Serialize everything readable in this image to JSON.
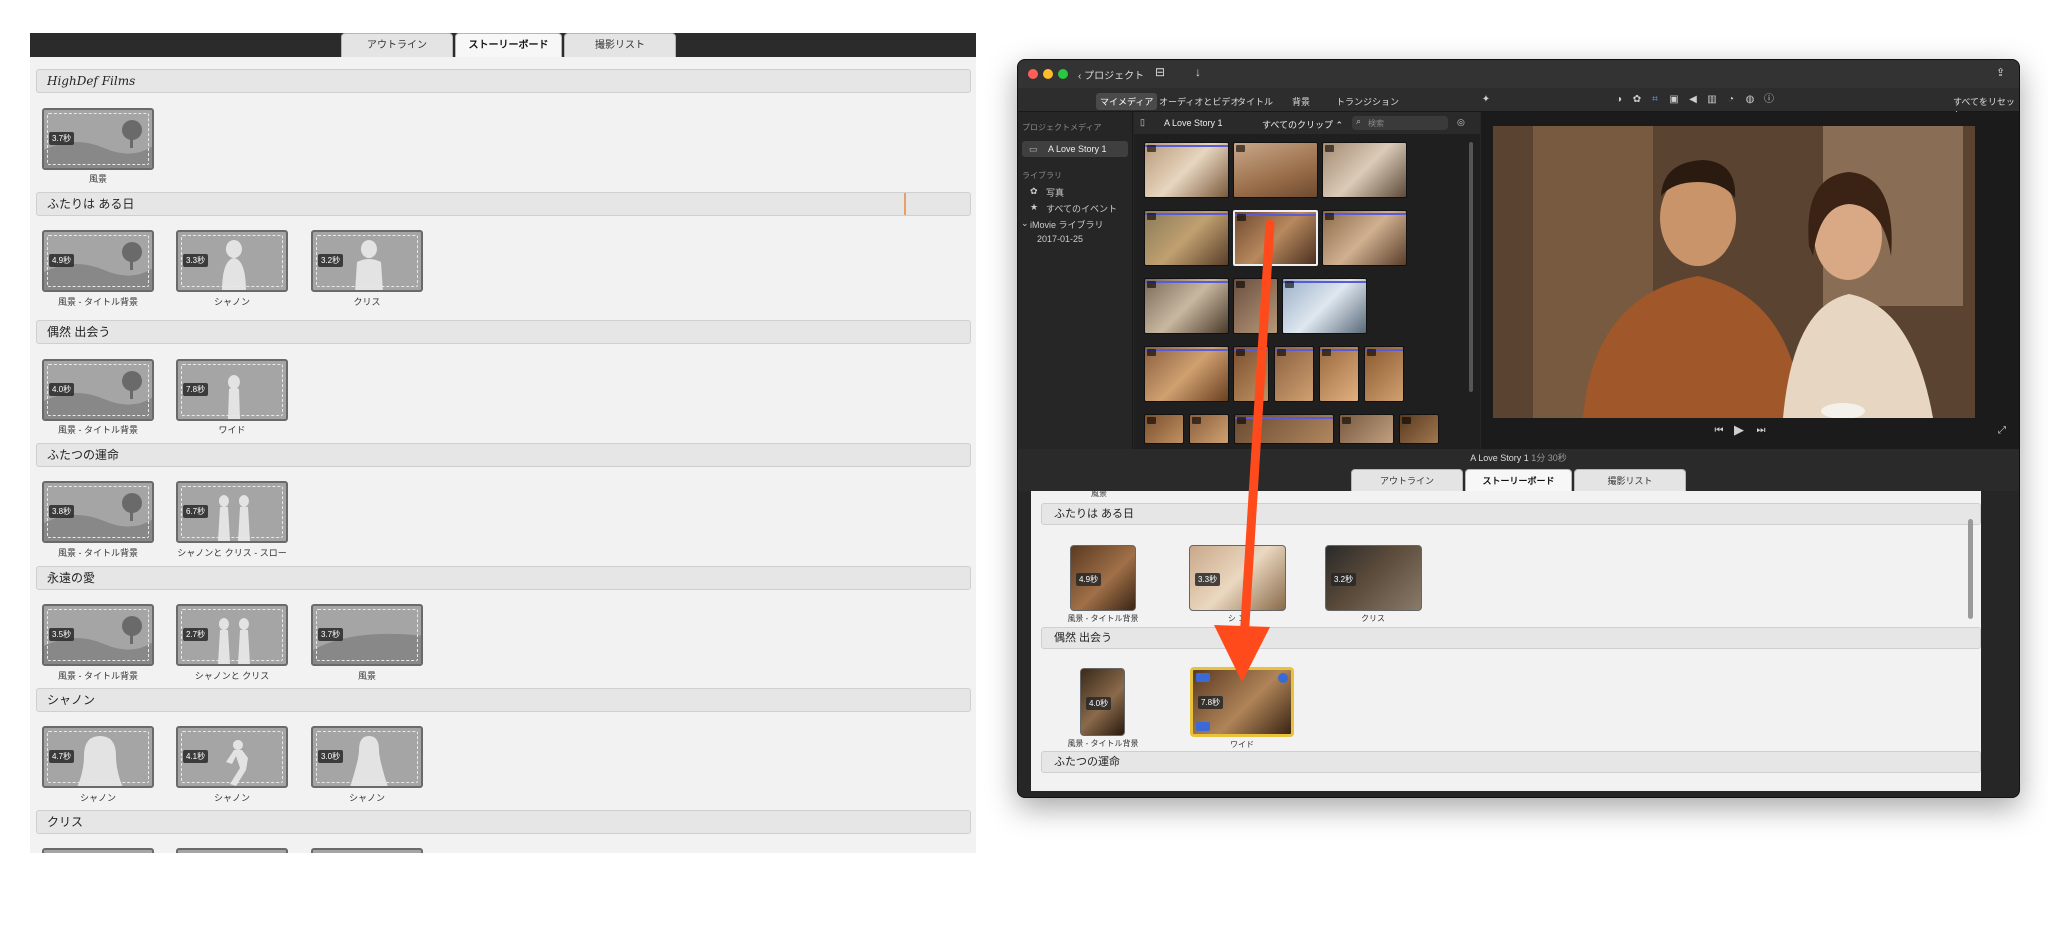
{
  "left": {
    "tabs": [
      "アウトライン",
      "ストーリーボード",
      "撮影リスト"
    ],
    "brand": "HighDef Films",
    "brand_clip": {
      "duration": "3.7秒",
      "caption": "風景"
    },
    "sections": [
      {
        "title": "ふたりは ある日",
        "clips": [
          {
            "duration": "4.9秒",
            "caption": "風景 - タイトル背景"
          },
          {
            "duration": "3.3秒",
            "caption": "シャノン"
          },
          {
            "duration": "3.2秒",
            "caption": "クリス"
          }
        ]
      },
      {
        "title": "偶然 出会う",
        "clips": [
          {
            "duration": "4.0秒",
            "caption": "風景 - タイトル背景"
          },
          {
            "duration": "7.8秒",
            "caption": "ワイド"
          }
        ]
      },
      {
        "title": "ふたつの運命",
        "clips": [
          {
            "duration": "3.8秒",
            "caption": "風景 - タイトル背景"
          },
          {
            "duration": "6.7秒",
            "caption": "シャノンと クリス - スロー"
          }
        ]
      },
      {
        "title": "永遠の愛",
        "clips": [
          {
            "duration": "3.5秒",
            "caption": "風景 - タイトル背景"
          },
          {
            "duration": "2.7秒",
            "caption": "シャノンと クリス"
          },
          {
            "duration": "3.7秒",
            "caption": "風景"
          }
        ]
      },
      {
        "title": "シャノン",
        "clips": [
          {
            "duration": "4.7秒",
            "caption": "シャノン"
          },
          {
            "duration": "4.1秒",
            "caption": "シャノン"
          },
          {
            "duration": "3.0秒",
            "caption": "シャノン"
          }
        ]
      },
      {
        "title": "クリス",
        "clips": []
      }
    ]
  },
  "imovie": {
    "back_label": "プロジェクト",
    "modes": [
      "マイメディア",
      "オーディオとビデオ",
      "タイトル",
      "背景",
      "トランジション"
    ],
    "reset_all": "すべてをリセット",
    "sidebar": {
      "project_media": "プロジェクトメディア",
      "project": "A Love Story 1",
      "library": "ライブラリ",
      "photos": "写真",
      "all_events": "すべてのイベント",
      "imovie_library": "iMovie ライブラリ",
      "event_date": "2017-01-25"
    },
    "browser": {
      "title": "A Love Story 1",
      "filter": "すべてのクリップ",
      "search_placeholder": "検索"
    },
    "project_title": "A Love Story 1",
    "project_duration": "1分 30秒",
    "tabs": [
      "アウトライン",
      "ストーリーボード",
      "撮影リスト"
    ],
    "storyboard": {
      "top_caption": "風景",
      "sections": [
        {
          "title": "ふたりは ある日",
          "clips": [
            {
              "duration": "4.9秒",
              "caption": "風景 - タイトル背景"
            },
            {
              "duration": "3.3秒",
              "caption": "シ    ン"
            },
            {
              "duration": "3.2秒",
              "caption": "クリス"
            }
          ]
        },
        {
          "title": "偶然 出会う",
          "clips": [
            {
              "duration": "4.0秒",
              "caption": "風景 - タイトル背景"
            },
            {
              "duration": "7.8秒",
              "caption": "ワイド"
            }
          ]
        },
        {
          "title": "ふたつの運命",
          "clips": []
        }
      ]
    }
  },
  "colors": {
    "arrow": "#ff4a1c",
    "selection": "#e8c23a",
    "timeline_bar": "#5b5bd6"
  }
}
